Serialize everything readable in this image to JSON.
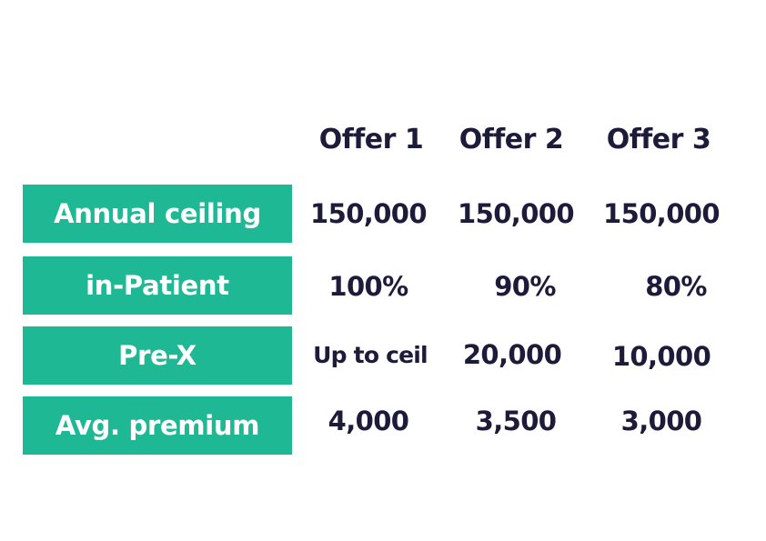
{
  "table": {
    "headers": [
      "Offer 1",
      "Offer 2",
      "Offer 3"
    ],
    "rows": [
      {
        "label": "Annual ceiling",
        "values": [
          "150,000",
          "150,000",
          "150,000"
        ]
      },
      {
        "label": "in-Patient",
        "values": [
          "100%",
          "90%",
          "80%"
        ]
      },
      {
        "label": "Pre-X",
        "values": [
          "Up to ceil",
          "20,000",
          "10,000"
        ]
      },
      {
        "label": "Avg. premium",
        "values": [
          "4,000",
          "3,500",
          "3,000"
        ]
      }
    ]
  },
  "colors": {
    "label_background": "#1fb895",
    "label_text": "#ffffff",
    "value_text": "#1d1b3a",
    "background": "#ffffff"
  }
}
